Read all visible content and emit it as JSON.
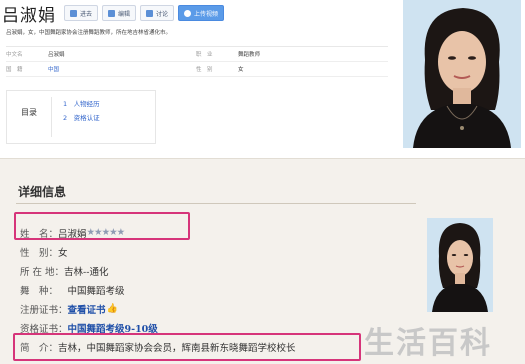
{
  "header": {
    "name": "吕淑娟",
    "buttons": [
      {
        "label": "进去",
        "primary": false
      },
      {
        "label": "编辑",
        "primary": false
      },
      {
        "label": "讨论",
        "primary": false
      },
      {
        "label": "上传视频",
        "primary": true
      }
    ],
    "summary": "吕淑娟，女，中国舞蹈家协会注册舞蹈教师，所在地吉林省通化市。"
  },
  "info_table": [
    [
      {
        "k": "中文名",
        "v": "吕淑娟"
      },
      {
        "k": "职　业",
        "v": "舞蹈教师"
      }
    ],
    [
      {
        "k": "国　籍",
        "v": "中国",
        "link": true
      },
      {
        "k": "性　别",
        "v": "女"
      }
    ]
  ],
  "toc": {
    "label": "目录",
    "items": [
      "1　人物经历",
      "2　资格认证"
    ]
  },
  "detail": {
    "title": "详细信息",
    "fields": [
      {
        "label": "姓　名：",
        "value": "吕淑娟",
        "stars": "★★★★★"
      },
      {
        "label": "性　别：",
        "value": "女"
      },
      {
        "label": "所 在 地：",
        "value": "吉林--通化"
      },
      {
        "label": "舞　种：",
        "value": "　中国舞蹈考级"
      },
      {
        "label": "注册证书：",
        "value": "查看证书",
        "blue": true,
        "thumb": true
      },
      {
        "label": "资格证书：",
        "value": "中国舞蹈考级9-10级",
        "blue": true
      },
      {
        "label": "简　介：",
        "value": "吉林，中国舞蹈家协会会员，辉南县新东晓舞蹈学校校长"
      }
    ]
  },
  "watermark": "生活百科",
  "colors": {
    "highlight": "#d6357a",
    "link": "#3366cc",
    "primary_button": "#5b9be8",
    "bottom_bg": "#f4f1ec"
  }
}
